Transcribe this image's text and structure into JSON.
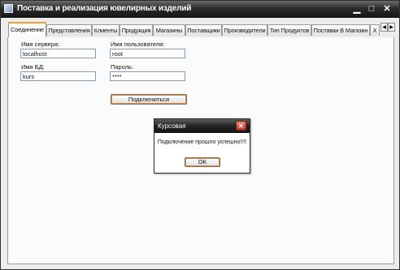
{
  "window": {
    "title": "Поставка и реализация ювелирных изделий",
    "controls": {
      "minimize": "▁",
      "maximize": "□",
      "close": "✕"
    }
  },
  "tabs": [
    {
      "label": "Соединение",
      "active": true
    },
    {
      "label": "Представления"
    },
    {
      "label": "Клиенты"
    },
    {
      "label": "Продукция"
    },
    {
      "label": "Магазины"
    },
    {
      "label": "Поставщики"
    },
    {
      "label": "Производители"
    },
    {
      "label": "Тип Продуктов"
    },
    {
      "label": "Поставки В Магазин"
    },
    {
      "label": "Х"
    }
  ],
  "tab_scroll": {
    "left": "◀",
    "right": "▶"
  },
  "connection": {
    "server_label": "Имя сервера:",
    "server_value": "localhost",
    "user_label": "Имя пользователя:",
    "user_value": "root",
    "db_label": "Имя БД:",
    "db_value": "kurs",
    "password_label": "Пароль:",
    "password_value": "****",
    "connect_button": "Подключиться"
  },
  "dialog": {
    "title": "Курсовая",
    "message": "Подключение прошло успешно!!!!",
    "ok_button": "OK",
    "close": "✕"
  },
  "colors": {
    "titlebar": "#151515",
    "tab_accent": "#e7a232",
    "dialog_close": "#c63a22"
  }
}
